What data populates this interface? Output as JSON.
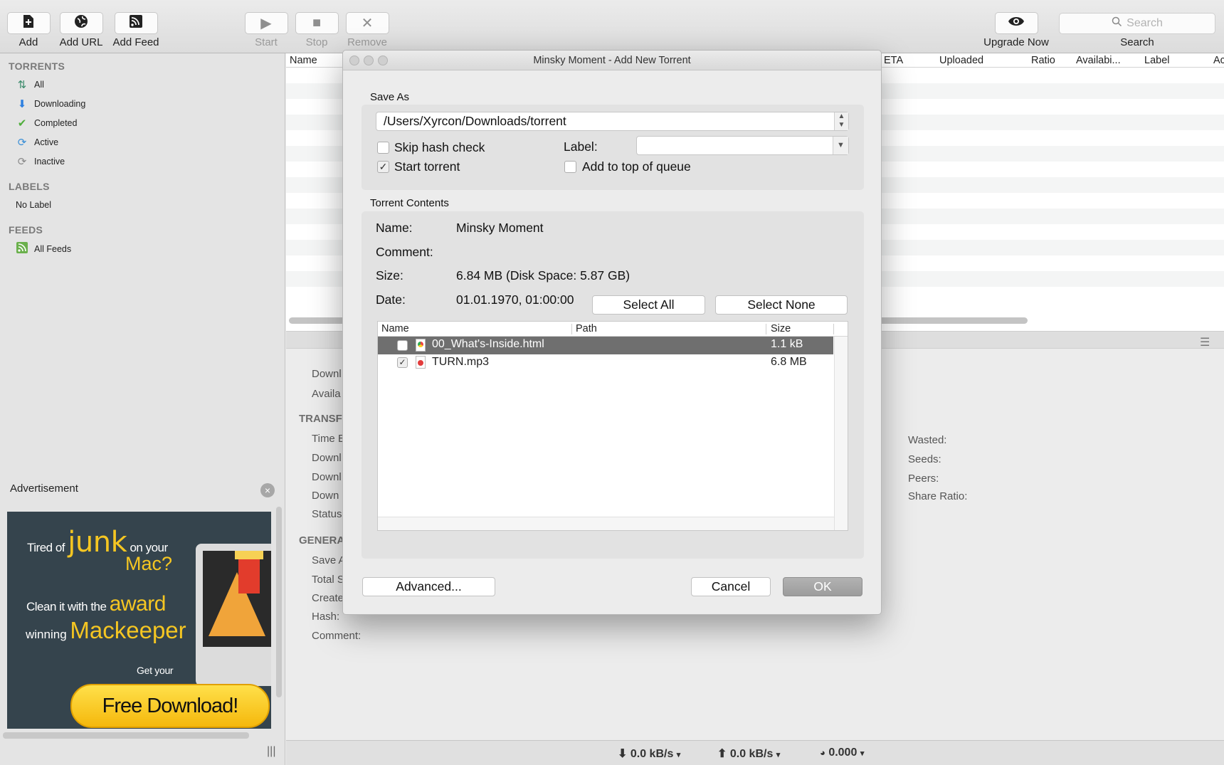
{
  "toolbar": {
    "add": "Add",
    "add_url": "Add URL",
    "add_feed": "Add Feed",
    "start": "Start",
    "stop": "Stop",
    "remove": "Remove",
    "upgrade": "Upgrade Now",
    "search_placeholder": "Search",
    "search_label": "Search"
  },
  "sidebar": {
    "torrents_header": "TORRENTS",
    "torrents": [
      "All",
      "Downloading",
      "Completed",
      "Active",
      "Inactive"
    ],
    "labels_header": "LABELS",
    "labels": [
      "No Label"
    ],
    "feeds_header": "FEEDS",
    "feeds": [
      "All Feeds"
    ]
  },
  "advertisement": {
    "title": "Advertisement",
    "line1a": "Tired of",
    "line1b": "junk",
    "line1c": "on your",
    "line2": "Mac?",
    "line3a": "Clean it with the",
    "line3b": "award",
    "line4a": "winning",
    "line4b": "Mackeeper",
    "line5": "Get your",
    "cta": "Free Download!"
  },
  "list": {
    "columns": [
      "Name",
      "ETA",
      "Uploaded",
      "Ratio",
      "Availabi...",
      "Label",
      "Ac"
    ]
  },
  "details": {
    "labels_left": [
      "Downl",
      "Availa"
    ],
    "transfer_header": "TRANSF",
    "transfer_labels": [
      "Time E",
      "Downl",
      "Downl",
      "Down",
      "Status"
    ],
    "general_header": "GENERA",
    "general_labels": [
      "Save A",
      "Total S",
      "Create",
      "Hash:",
      "Comment:"
    ],
    "right_labels": [
      "Wasted:",
      "Seeds:",
      "Peers:",
      "Share Ratio:"
    ]
  },
  "statusbar": {
    "down": "0.0 kB/s",
    "up": "0.0 kB/s",
    "ratio": "0.000"
  },
  "dialog": {
    "title": "Minsky Moment - Add New Torrent",
    "save_as_label": "Save As",
    "save_path": "/Users/Xyrcon/Downloads/torrent",
    "skip_hash": "Skip hash check",
    "skip_hash_checked": false,
    "start_torrent": "Start torrent",
    "start_torrent_checked": true,
    "label_label": "Label:",
    "label_value": "",
    "add_top": "Add to top of queue",
    "add_top_checked": false,
    "contents_label": "Torrent Contents",
    "name_key": "Name:",
    "name_val": "Minsky Moment",
    "comment_key": "Comment:",
    "comment_val": "",
    "size_key": "Size:",
    "size_val": "6.84 MB (Disk Space: 5.87 GB)",
    "date_key": "Date:",
    "date_val": "01.01.1970, 01:00:00",
    "select_all": "Select All",
    "select_none": "Select None",
    "file_columns": [
      "Name",
      "Path",
      "Size"
    ],
    "files": [
      {
        "name": "00_What's-Inside.html",
        "size": "1.1 kB",
        "checked": false,
        "selected": true
      },
      {
        "name": "TURN.mp3",
        "size": "6.8 MB",
        "checked": true,
        "selected": false
      }
    ],
    "advanced": "Advanced...",
    "cancel": "Cancel",
    "ok": "OK"
  }
}
